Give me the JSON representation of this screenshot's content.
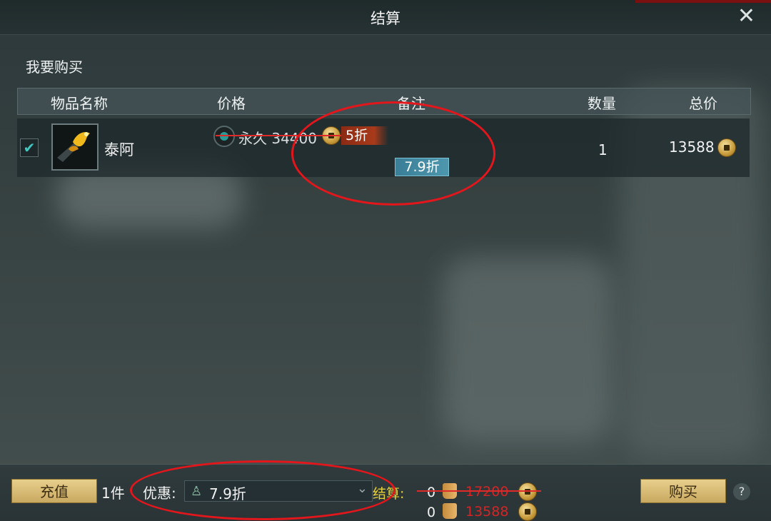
{
  "window": {
    "title": "结算"
  },
  "section": {
    "label": "我要购买"
  },
  "table": {
    "headers": [
      "物品名称",
      "价格",
      "备注",
      "数量",
      "总价"
    ]
  },
  "item": {
    "checked": true,
    "name": "泰阿",
    "price_option": "永久 34400",
    "badge_discount": "5折",
    "note_discount": "7.9折",
    "quantity": "1",
    "total": "13588"
  },
  "footer": {
    "recharge_label": "充值",
    "count": "1件",
    "discount_label": "优惠:",
    "discount_value": "7.9折",
    "settle_label": "结算:",
    "line1_zero": "0",
    "line1_amount": "17200",
    "line2_zero": "0",
    "line2_amount": "13588",
    "buy_label": "购买",
    "help": "?"
  },
  "icons": {
    "close": "close-icon",
    "check": "check-icon",
    "coin": "coin-icon",
    "discount": "discount-icon",
    "chevron": "chevron-down-icon",
    "help": "help-icon"
  },
  "colors": {
    "accent_red": "#d32525",
    "gold": "#c9a961",
    "settle_yellow": "#e9d237",
    "badge_blue": "#4d97ae"
  }
}
